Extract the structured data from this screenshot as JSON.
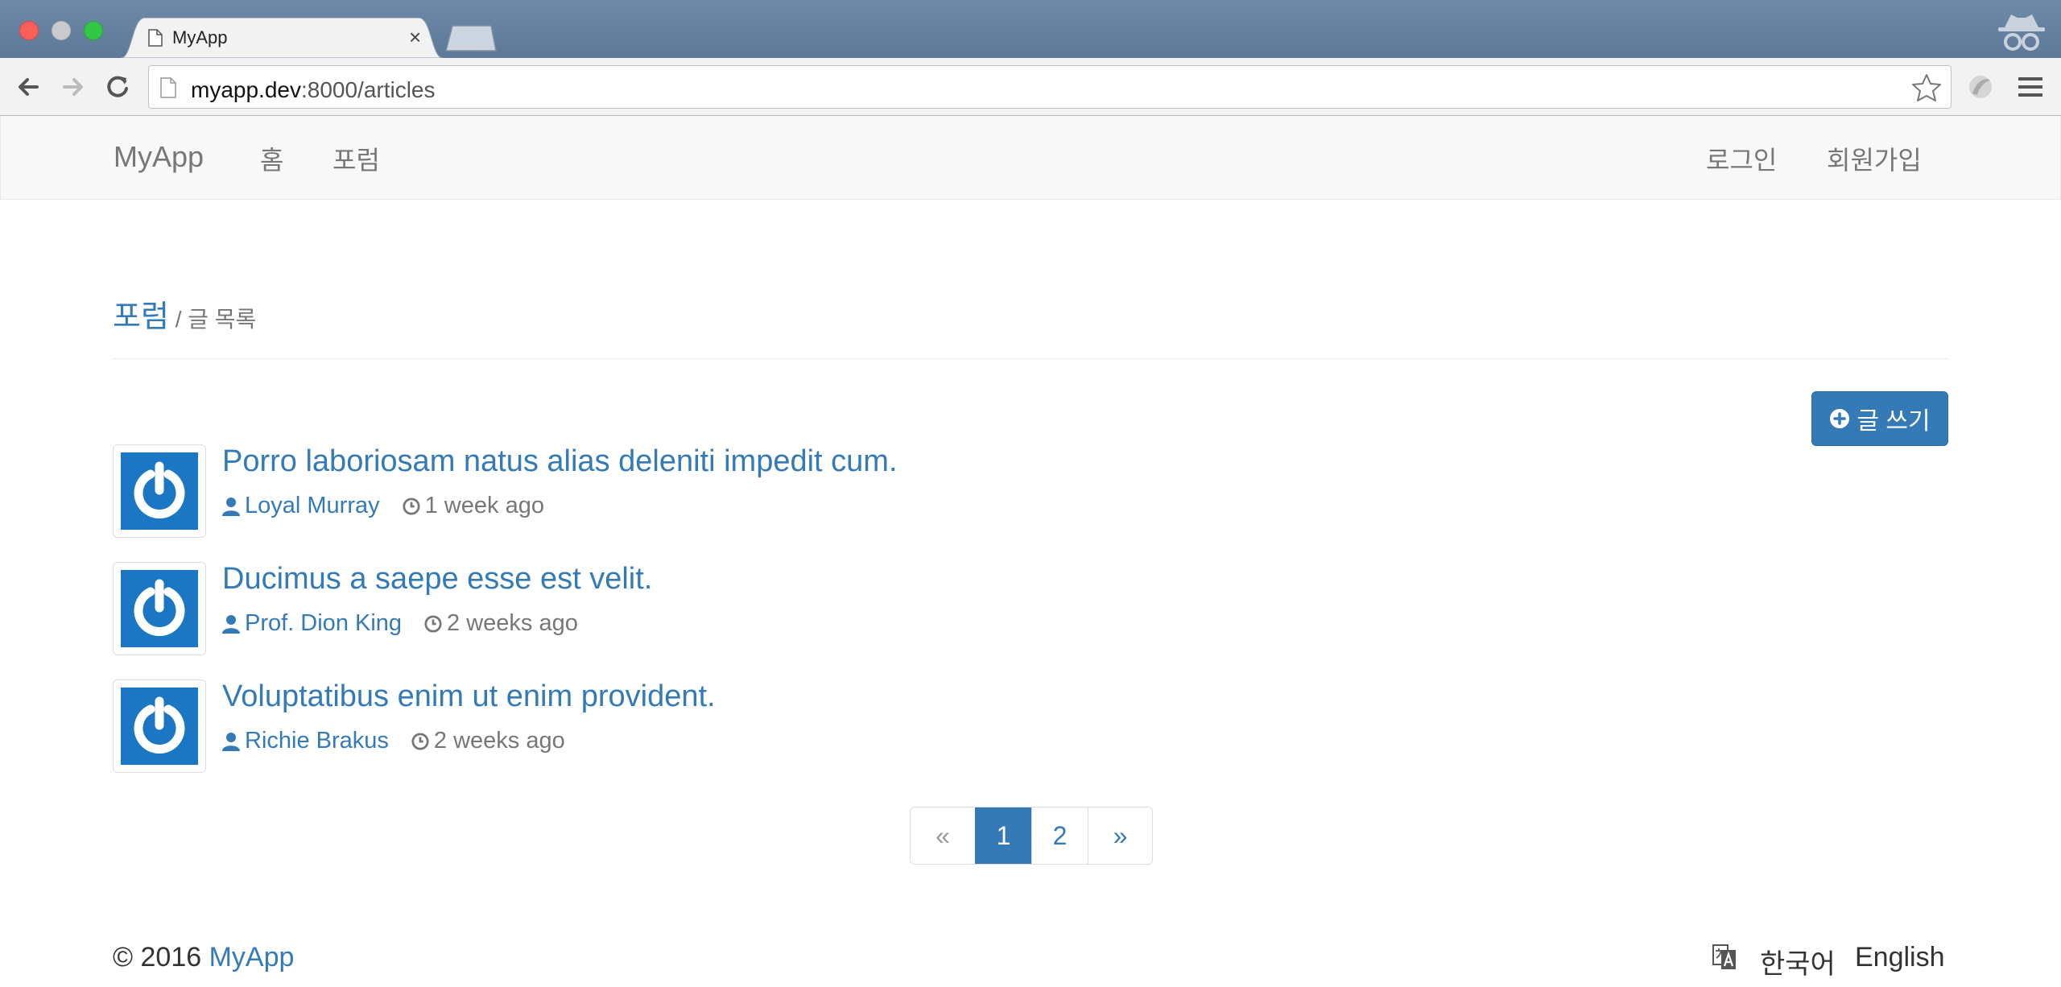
{
  "browser": {
    "tab_title": "MyApp",
    "tab_close": "×",
    "url_host": "myapp.dev",
    "url_rest": ":8000/articles"
  },
  "navbar": {
    "brand": "MyApp",
    "home": "홈",
    "forum": "포럼",
    "login": "로그인",
    "register": "회원가입"
  },
  "header": {
    "section": "포럼",
    "separator": " / 글 목록"
  },
  "write_button": {
    "label": "글 쓰기"
  },
  "articles": [
    {
      "title": "Porro laboriosam natus alias deleniti impedit cum.",
      "author": "Loyal Murray",
      "time": "1 week ago"
    },
    {
      "title": "Ducimus a saepe esse est velit.",
      "author": "Prof. Dion King",
      "time": "2 weeks ago"
    },
    {
      "title": "Voluptatibus enim ut enim provident.",
      "author": "Richie Brakus",
      "time": "2 weeks ago"
    }
  ],
  "pagination": {
    "prev": "«",
    "pages": [
      "1",
      "2"
    ],
    "active": "1",
    "next": "»"
  },
  "footer": {
    "copyright": "© 2016",
    "app_link": "MyApp",
    "lang_ko": "한국어",
    "lang_en": "English"
  },
  "colors": {
    "accent": "#337ab7",
    "avatar": "#1b77c3",
    "navbar_bg": "#f8f8f8"
  },
  "icons": [
    "document-icon",
    "back-arrow-icon",
    "forward-arrow-icon",
    "reload-icon",
    "bookmark-star-icon",
    "menu-icon",
    "incognito-icon",
    "plus-circle-icon",
    "user-icon",
    "clock-icon",
    "power-icon",
    "translate-icon"
  ]
}
